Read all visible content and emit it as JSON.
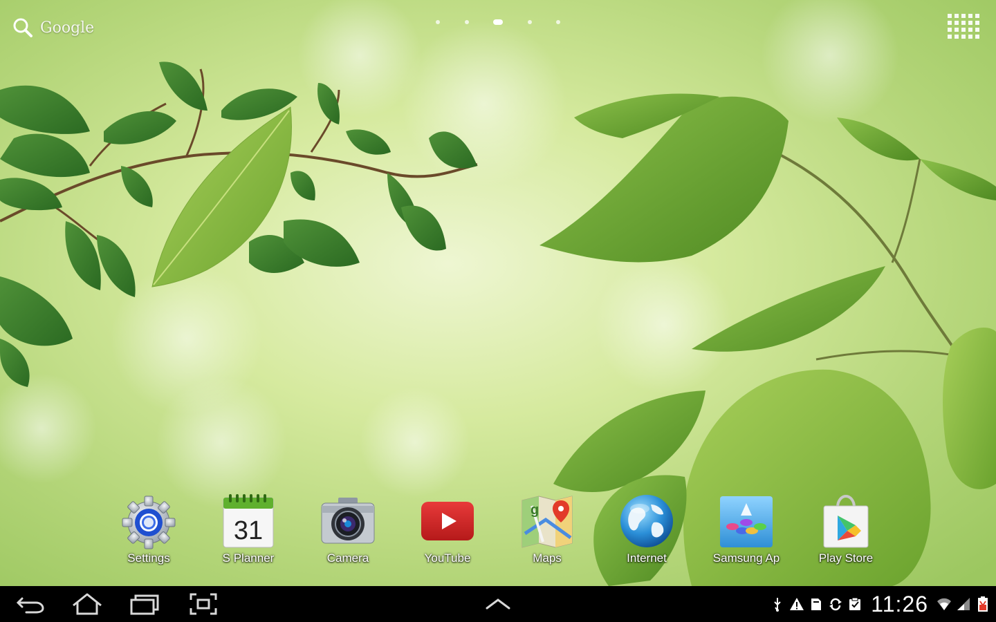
{
  "search": {
    "label": "Google"
  },
  "pages": {
    "count": 5,
    "current": 3
  },
  "dock": {
    "apps": [
      {
        "id": "settings",
        "label": "Settings",
        "icon": "settings-gear-icon"
      },
      {
        "id": "s-planner",
        "label": "S Planner",
        "icon": "calendar-icon",
        "calendar_day": "31"
      },
      {
        "id": "camera",
        "label": "Camera",
        "icon": "camera-icon"
      },
      {
        "id": "youtube",
        "label": "YouTube",
        "icon": "youtube-play-icon"
      },
      {
        "id": "maps",
        "label": "Maps",
        "icon": "map-pin-icon"
      },
      {
        "id": "internet",
        "label": "Internet",
        "icon": "globe-icon"
      },
      {
        "id": "samsung-apps",
        "label": "Samsung Ap",
        "icon": "samsung-apps-icon"
      },
      {
        "id": "play-store",
        "label": "Play Store",
        "icon": "play-store-bag-icon"
      }
    ]
  },
  "navbar": {
    "buttons": [
      "back",
      "home",
      "recent-apps",
      "screenshot"
    ],
    "status_icons": [
      "usb-icon",
      "warning-icon",
      "sd-card-icon",
      "sync-icon",
      "clipboard-check-icon",
      "wifi-icon",
      "signal-icon",
      "battery-icon"
    ]
  },
  "status": {
    "time": "11:26"
  },
  "colors": {
    "navbar_bg": "#000000",
    "youtube_red": "#d32222",
    "battery_warning": "#e23a2a",
    "leaf_green": "#5e9a2c"
  }
}
